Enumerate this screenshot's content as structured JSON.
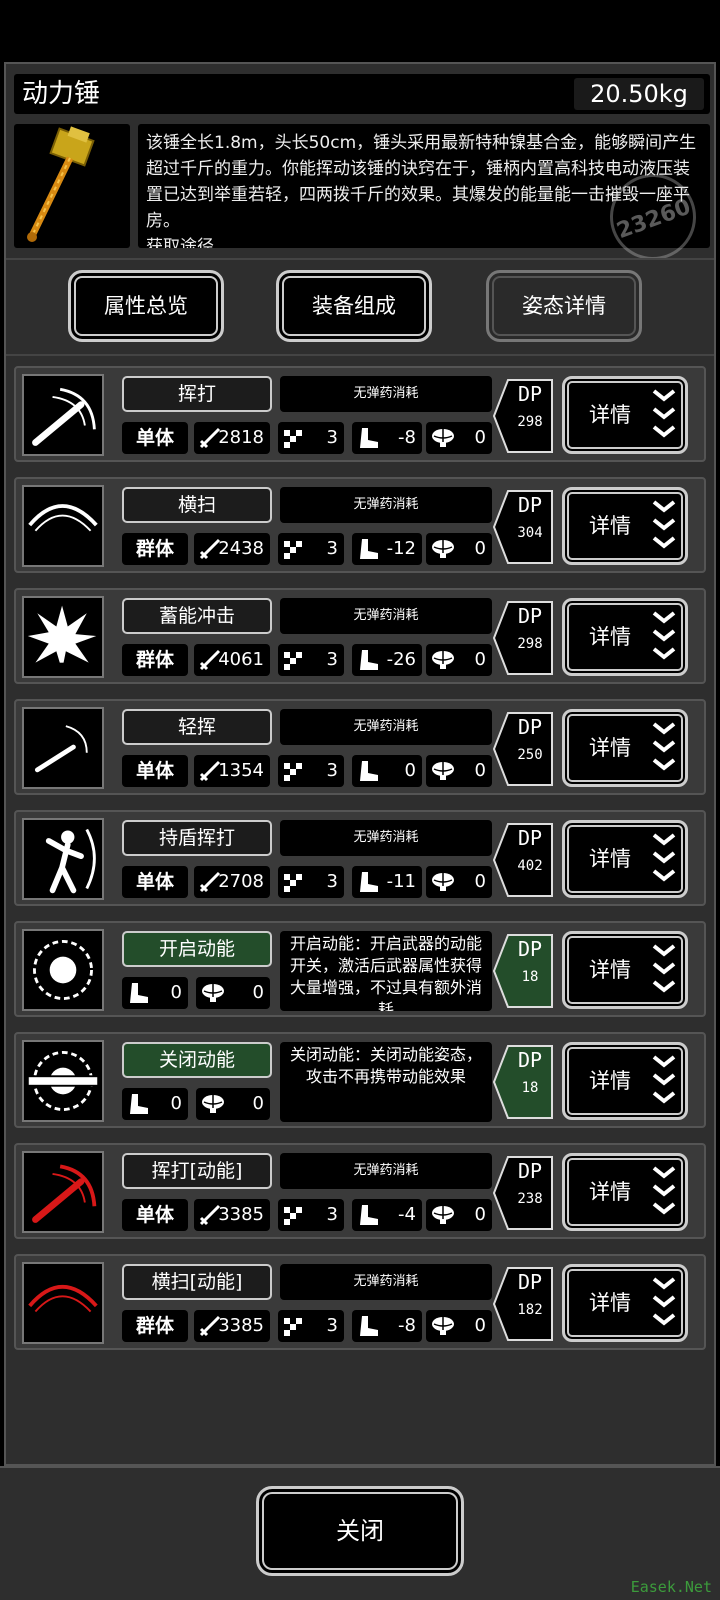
{
  "item": {
    "name": "动力锤",
    "weight": "20.50kg",
    "description": "该锤全长1.8m，头长50cm，锤头采用最新特种镍基合金，能够瞬间产生超过千斤的重力。你能挥动该锤的诀窍在于，锤柄内置高科技电动液压装置已达到举重若轻，四两拨千斤的效果。其爆发的能量能一击摧毁一座平房。\n获取途径",
    "stamp": "23260"
  },
  "tabs": [
    {
      "label": "属性总览"
    },
    {
      "label": "装备组成"
    },
    {
      "label": "姿态详情",
      "active": true
    }
  ],
  "skills": [
    {
      "name": "挥打",
      "ammo": "无弹药消耗",
      "target": "单体",
      "damage": "2818",
      "hit": "3",
      "move": "-8",
      "brain": "0",
      "dp": "298",
      "detail": "详情",
      "icon": "swing-icon"
    },
    {
      "name": "横扫",
      "ammo": "无弹药消耗",
      "target": "群体",
      "damage": "2438",
      "hit": "3",
      "move": "-12",
      "brain": "0",
      "dp": "304",
      "detail": "详情",
      "icon": "sweep-icon"
    },
    {
      "name": "蓄能冲击",
      "ammo": "无弹药消耗",
      "target": "群体",
      "damage": "4061",
      "hit": "3",
      "move": "-26",
      "brain": "0",
      "dp": "298",
      "detail": "详情",
      "icon": "burst-icon"
    },
    {
      "name": "轻挥",
      "ammo": "无弹药消耗",
      "target": "单体",
      "damage": "1354",
      "hit": "3",
      "move": "0",
      "brain": "0",
      "dp": "250",
      "detail": "详情",
      "icon": "light-swing-icon"
    },
    {
      "name": "持盾挥打",
      "ammo": "无弹药消耗",
      "target": "单体",
      "damage": "2708",
      "hit": "3",
      "move": "-11",
      "brain": "0",
      "dp": "402",
      "detail": "详情",
      "icon": "shield-swing-icon"
    },
    {
      "name": "开启动能",
      "note": "开启动能：开启武器的动能开关，激活后武器属性获得大量增强，不过具有额外消耗",
      "move": "0",
      "brain": "0",
      "dp": "18",
      "detail": "详情",
      "icon": "power-on-icon",
      "toggle": true
    },
    {
      "name": "关闭动能",
      "note": "关闭动能：关闭动能姿态，攻击不再携带动能效果",
      "move": "0",
      "brain": "0",
      "dp": "18",
      "detail": "详情",
      "icon": "power-off-icon",
      "toggle": true
    },
    {
      "name": "挥打[动能]",
      "ammo": "无弹药消耗",
      "target": "单体",
      "damage": "3385",
      "hit": "3",
      "move": "-4",
      "brain": "0",
      "dp": "238",
      "detail": "详情",
      "icon": "red-swing-icon"
    },
    {
      "name": "横扫[动能]",
      "ammo": "无弹药消耗",
      "target": "群体",
      "damage": "3385",
      "hit": "3",
      "move": "-8",
      "brain": "0",
      "dp": "182",
      "detail": "详情",
      "icon": "red-sweep-icon"
    }
  ],
  "dp_label": "DP",
  "close_label": "关闭",
  "watermark": "Easek.Net",
  "colors": {
    "toggle_green": "#234d2a",
    "red_icon": "#d81818"
  }
}
